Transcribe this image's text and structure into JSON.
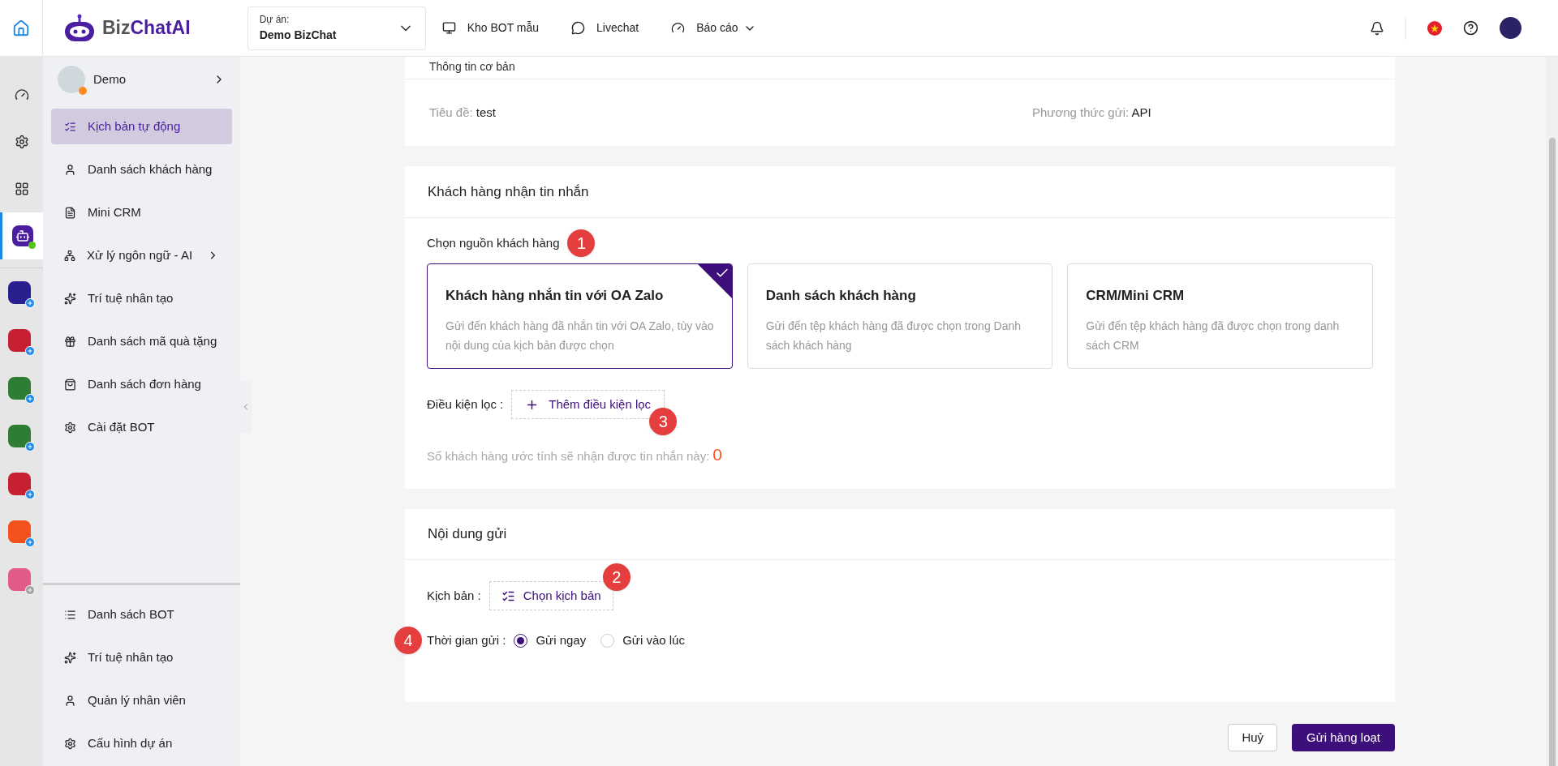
{
  "topbar": {
    "brand": {
      "part1": "Biz",
      "part2": "ChatAI"
    },
    "project": {
      "label": "Dự án:",
      "value": "Demo BizChat"
    },
    "nav": [
      {
        "label": "Kho BOT mẫu",
        "dropdown": false
      },
      {
        "label": "Livechat",
        "dropdown": false
      },
      {
        "label": "Báo cáo",
        "dropdown": true
      }
    ]
  },
  "rail": {
    "items": [
      {
        "kind": "dashboard",
        "selected": false
      },
      {
        "kind": "settings",
        "selected": false
      },
      {
        "kind": "apps",
        "selected": false
      },
      {
        "kind": "bot",
        "selected": true
      }
    ],
    "bots": [
      {
        "color": "#2a1f8f",
        "enabled": true
      },
      {
        "color": "#c62032",
        "enabled": true
      },
      {
        "color": "#2e7d32",
        "enabled": true
      },
      {
        "color": "#2e7d32",
        "enabled": true
      },
      {
        "color": "#c62032",
        "enabled": true
      },
      {
        "color": "#f4511e",
        "enabled": true
      },
      {
        "color": "#e05a8a",
        "enabled": false
      }
    ]
  },
  "sidebar": {
    "bot_name": "Demo",
    "items": [
      {
        "label": "Kịch bản tự động",
        "selected": true,
        "submenu": false
      },
      {
        "label": "Danh sách khách hàng",
        "selected": false,
        "submenu": false
      },
      {
        "label": "Mini CRM",
        "selected": false,
        "submenu": false
      },
      {
        "label": "Xử lý ngôn ngữ - AI",
        "selected": false,
        "submenu": true
      },
      {
        "label": "Trí tuệ nhân tạo",
        "selected": false,
        "submenu": false
      },
      {
        "label": "Danh sách mã quà tặng",
        "selected": false,
        "submenu": false
      },
      {
        "label": "Danh sách đơn hàng",
        "selected": false,
        "submenu": false
      },
      {
        "label": "Cài đặt BOT",
        "selected": false,
        "submenu": false
      }
    ],
    "bottom_items": [
      {
        "label": "Danh sách BOT"
      },
      {
        "label": "Trí tuệ nhân tạo"
      },
      {
        "label": "Quản lý nhân viên"
      },
      {
        "label": "Cấu hình dự án"
      }
    ]
  },
  "basic_info": {
    "title": "Thông tin cơ bản",
    "fields": [
      {
        "label": "Tiêu đề:",
        "value": "test"
      },
      {
        "label": "Phương thức gửi:",
        "value": "API"
      }
    ]
  },
  "recipients": {
    "title": "Khách hàng nhận tin nhắn",
    "source_label": "Chọn nguồn khách hàng",
    "source_marker": "1",
    "sources": [
      {
        "title": "Khách hàng nhắn tin với OA Zalo",
        "description": "Gửi đến khách hàng đã nhắn tin với OA Zalo, tùy vào nội dung của kịch bản được chọn",
        "selected": true
      },
      {
        "title": "Danh sách khách hàng",
        "description": "Gửi đến tệp khách hàng đã được chọn trong Danh sách khách hàng",
        "selected": false
      },
      {
        "title": "CRM/Mini CRM",
        "description": "Gửi đến tệp khách hàng đã được chọn trong danh sách CRM",
        "selected": false
      }
    ],
    "filter_label": "Điều kiện lọc :",
    "filter_button": "Thêm điều kiện lọc",
    "filter_marker": "3",
    "estimate_label": "Số khách hàng ước tính sẽ nhận được tin nhắn này:",
    "estimate_value": "0"
  },
  "content": {
    "title": "Nội dung gửi",
    "script_label": "Kịch bản :",
    "script_button": "Chọn kịch bản",
    "script_marker": "2",
    "time_label": "Thời gian gửi :",
    "time_marker": "4",
    "time_options": [
      {
        "label": "Gửi ngay",
        "selected": true
      },
      {
        "label": "Gửi vào lúc",
        "selected": false
      }
    ]
  },
  "actions": {
    "cancel": "Huỷ",
    "submit": "Gửi hàng loạt"
  }
}
